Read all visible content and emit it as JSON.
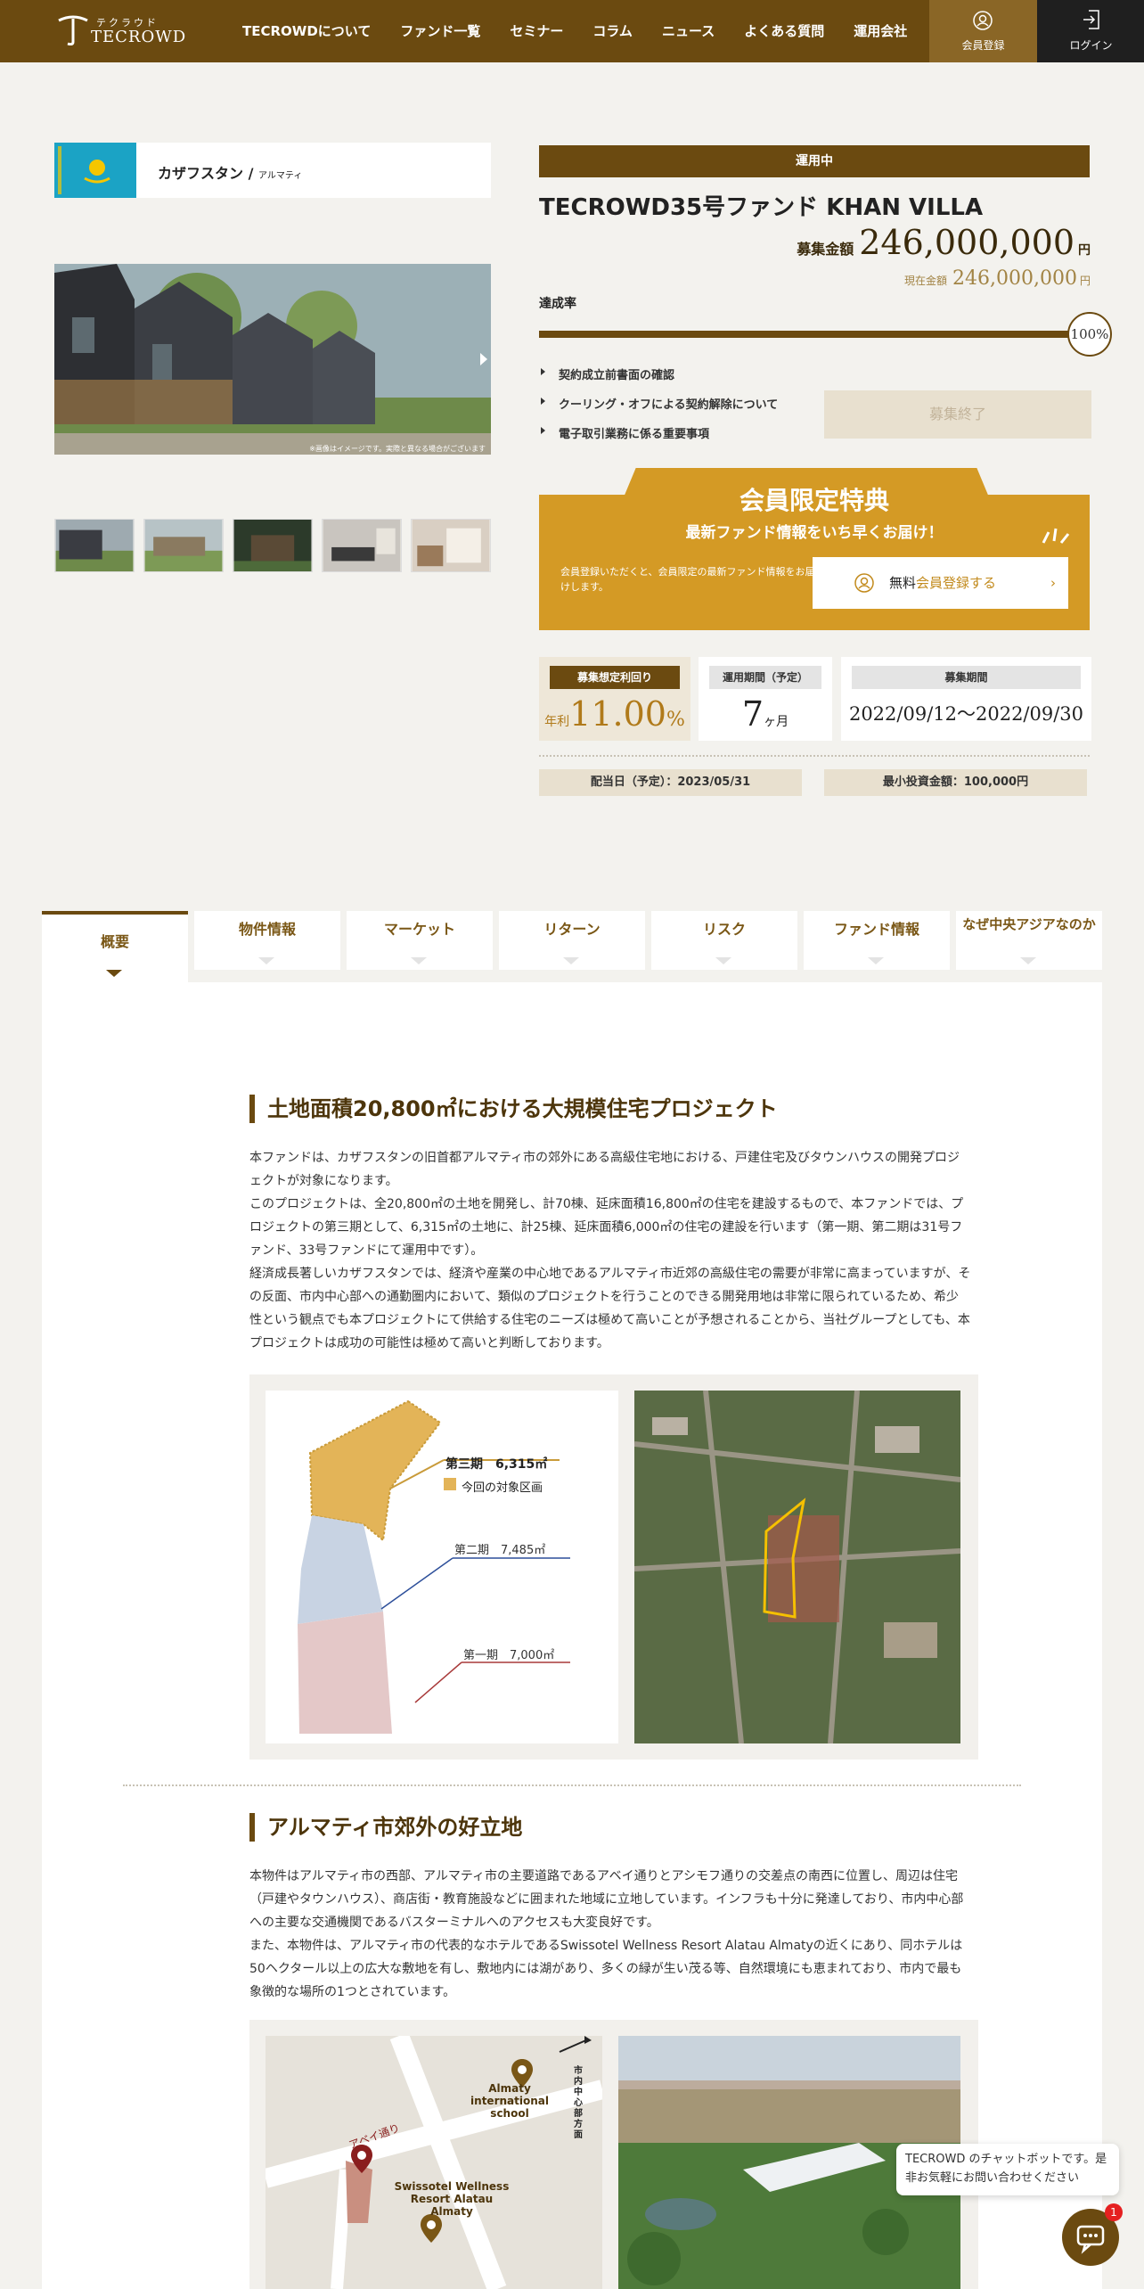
{
  "header": {
    "logo_kana": "テクラウド",
    "logo_text": "TECROWD",
    "nav": [
      "TECROWDについて",
      "ファンド一覧",
      "セミナー",
      "コラム",
      "ニュース",
      "よくある質問",
      "運用会社"
    ],
    "register_label": "会員登録",
    "login_label": "ログイン"
  },
  "location": {
    "country": "カザフスタン",
    "separator": "/",
    "city": "アルマティ"
  },
  "gallery": {
    "caption": "※画像はイメージです。実際と異なる場合がございます"
  },
  "fund": {
    "status": "運用中",
    "title": "TECROWD35号ファンド KHAN VILLA",
    "amount_label": "募集金額",
    "amount_value": "246,000,000",
    "amount_unit": "円",
    "current_label": "現在金額",
    "current_value": "246,000,000",
    "current_unit": "円",
    "rate_label": "達成率",
    "rate_text": "100%",
    "rate_fraction": 1.0,
    "docs": [
      "契約成立前書面の確認",
      "クーリング・オフによる契約解除について",
      "電子取引業務に係る重要事項"
    ],
    "closed_button": "募集終了"
  },
  "member": {
    "title": "会員限定特典",
    "subtitle": "最新ファンド情報をいち早くお届け！",
    "desc": "会員登録いただくと、会員限定の最新ファンド情報をお届けします。",
    "btn_prefix": "無料",
    "btn_label": "会員登録する"
  },
  "stats": {
    "yield_label": "募集想定利回り",
    "yield_prefix": "年利",
    "yield_value": "11.00",
    "yield_unit": "%",
    "period_label": "運用期間（予定）",
    "period_value": "7",
    "period_unit": "ヶ月",
    "recruit_label": "募集期間",
    "recruit_value": "2022/09/12〜2022/09/30"
  },
  "info": {
    "dividend": "配当日（予定）：2023/05/31",
    "min_invest": "最小投資金額：100,000円"
  },
  "tabs": [
    "概要",
    "物件情報",
    "マーケット",
    "リターン",
    "リスク",
    "ファンド情報",
    "なぜ中央アジアなのか"
  ],
  "section1": {
    "heading": "土地面積20,800㎡における大規模住宅プロジェクト",
    "body": "本ファンドは、カザフスタンの旧首都アルマティ市の郊外にある高級住宅地における、戸建住宅及びタウンハウスの開発プロジェクトが対象になります。\nこのプロジェクトは、全20,800㎡の土地を開発し、計70棟、延床面積16,800㎡の住宅を建設するもので、本ファンドでは、プロジェクトの第三期として、6,315㎡の土地に、計25棟、延床面積6,000㎡の住宅の建設を行います（第一期、第二期は31号ファンド、33号ファンドにて運用中です）。\n経済成長著しいカザフスタンでは、経済や産業の中心地であるアルマティ市近郊の高級住宅の需要が非常に高まっていますが、その反面、市内中心部への通勤圏内において、類似のプロジェクトを行うことのできる開発用地は非常に限られているため、希少性という観点でも本プロジェクトにて供給する住宅のニーズは極めて高いことが予想されることから、当社グループとしても、本プロジェクトは成功の可能性は極めて高いと判断しております。",
    "map_phase3": "第三期　6,315㎡",
    "map_target": "今回の対象区画",
    "map_phase2": "第二期　7,485㎡",
    "map_phase1": "第一期　7,000㎡"
  },
  "section2": {
    "heading": "アルマティ市郊外の好立地",
    "body": "本物件はアルマティ市の西部、アルマティ市の主要道路であるアベイ通りとアシモフ通りの交差点の南西に位置し、周辺は住宅（戸建やタウンハウス）、商店街・教育施設などに囲まれた地域に立地しています。インフラも十分に発達しており、市内中心部への主要な交通機関であるバスターミナルへのアクセスも大変良好です。\nまた、本物件は、アルマティ市の代表的なホテルであるSwissotel Wellness Resort Alatau Almatyの近くにあり、同ホテルは50ヘクタール以上の広大な敷地を有し、敷地内には湖があり、多くの緑が生い茂る等、自然環境にも恵まれており、市内で最も象徴的な場所の1つとされています。",
    "map_school": "Almaty international school",
    "map_hotel": "Swissotel Wellness Resort Alatau Almaty",
    "map_road": "アベイ通り",
    "map_direction": "市内中心部方面"
  },
  "chat": {
    "message": "TECROWD のチャットボットです。是非お気軽にお問い合わせください",
    "badge": "1"
  },
  "colors": {
    "brand": "#6b4a10",
    "accent": "#d49a25",
    "bg": "#f3f2ee"
  }
}
